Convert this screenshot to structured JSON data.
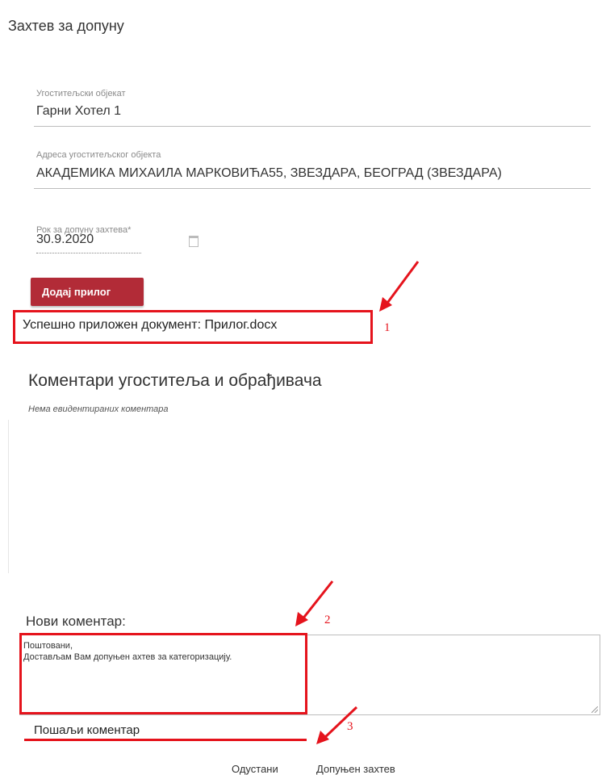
{
  "page": {
    "title": "Захтев за допуну"
  },
  "form": {
    "facility": {
      "label": "Угоститељски објекат",
      "value": "Гарни Хотел 1"
    },
    "address": {
      "label": "Адреса угоститељског објекта",
      "value": "АКАДЕМИКА МИХАИЛА МАРКОВИЋА55, ЗВЕЗДАРА, БЕОГРАД (ЗВЕЗДАРА)"
    },
    "deadline": {
      "label": "Рок за допуну захтева*",
      "value": "30.9.2020",
      "icon": "calendar-icon"
    }
  },
  "attach": {
    "button_label": "Додај прилог",
    "success_message": "Успешно приложен документ: Прилог.docx"
  },
  "comments": {
    "title": "Коментари угоститеља и обрађивача",
    "empty_note": "Нема евидентираних коментара"
  },
  "new_comment": {
    "label": "Нови коментар:",
    "lines": [
      "Поштовани,",
      "Достављам Вам допуњен ахтев за категоризацију."
    ],
    "send_label": "Пошаљи коментар"
  },
  "footer": {
    "cancel_label": "Одустани",
    "complete_label": "Допуњен захтев"
  },
  "annotations": {
    "marker_1": "1",
    "marker_2": "2",
    "marker_3": "3",
    "color": "#e5131c"
  }
}
